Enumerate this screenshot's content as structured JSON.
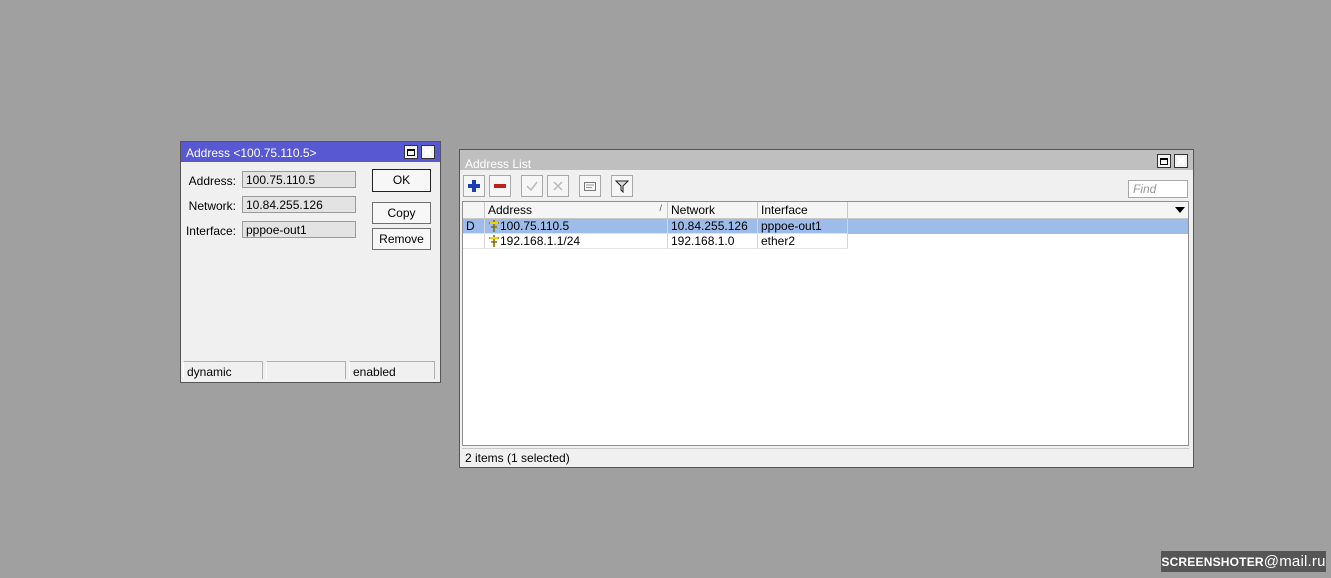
{
  "dialog": {
    "title": "Address <100.75.110.5>",
    "fields": [
      {
        "label": "Address:",
        "value": "100.75.110.5"
      },
      {
        "label": "Network:",
        "value": "10.84.255.126"
      },
      {
        "label": "Interface:",
        "value": "pppoe-out1"
      }
    ],
    "buttons": {
      "ok": "OK",
      "copy": "Copy",
      "remove": "Remove"
    },
    "status": [
      "dynamic",
      "",
      "enabled"
    ]
  },
  "address_list": {
    "title": "Address List",
    "find_placeholder": "Find",
    "columns": [
      "Address",
      "Network",
      "Interface"
    ],
    "rows": [
      {
        "flag": "D",
        "address": "100.75.110.5",
        "network": "10.84.255.126",
        "interface": "pppoe-out1",
        "selected": true
      },
      {
        "flag": "",
        "address": "192.168.1.1/24",
        "network": "192.168.1.0",
        "interface": "ether2",
        "selected": false
      }
    ],
    "status": "2 items (1 selected)"
  },
  "watermark": {
    "left": "SCREENSHOTER",
    "at": "@",
    "right": "mail.ru"
  },
  "colors": {
    "dialog_title": "#5858d2",
    "selected_row": "#9dbcea",
    "add_icon": "#1a3fb5",
    "remove_icon": "#c0201a"
  }
}
